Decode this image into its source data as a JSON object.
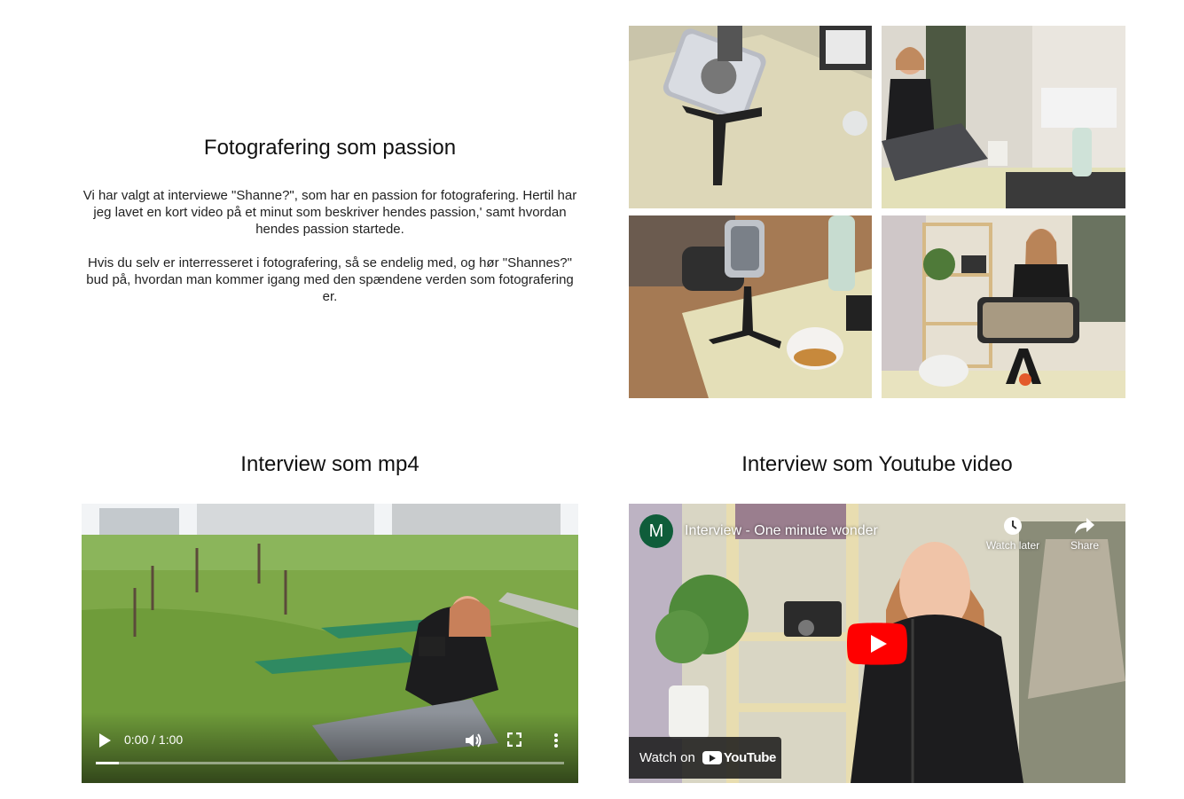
{
  "intro": {
    "title": "Fotografering som passion",
    "paragraph1": "Vi har valgt at interviewe \"Shanne?\", som har en passion for fotografering. Hertil har jeg lavet en kort video på et minut som beskriver hendes passion,' samt hvordan hendes passion startede.",
    "paragraph2": "Hvis du selv er interresseret i fotografering, så se endelig med, og hør \"Shannes?\" bud på, hvordan man kommer igang med den spændene verden som fotografering er."
  },
  "mp4_section": {
    "title": "Interview som mp4",
    "time": "0:00 / 1:00",
    "progress": 0.05
  },
  "youtube_section": {
    "title": "Interview som Youtube video",
    "channel_initial": "M",
    "video_title": "Interview - One minute wonder",
    "watch_later": "Watch later",
    "share": "Share",
    "watch_on": "Watch on",
    "youtube": "YouTube"
  },
  "colors": {
    "youtube_red": "#ff0000",
    "channel_avatar": "#0f5d3a"
  }
}
